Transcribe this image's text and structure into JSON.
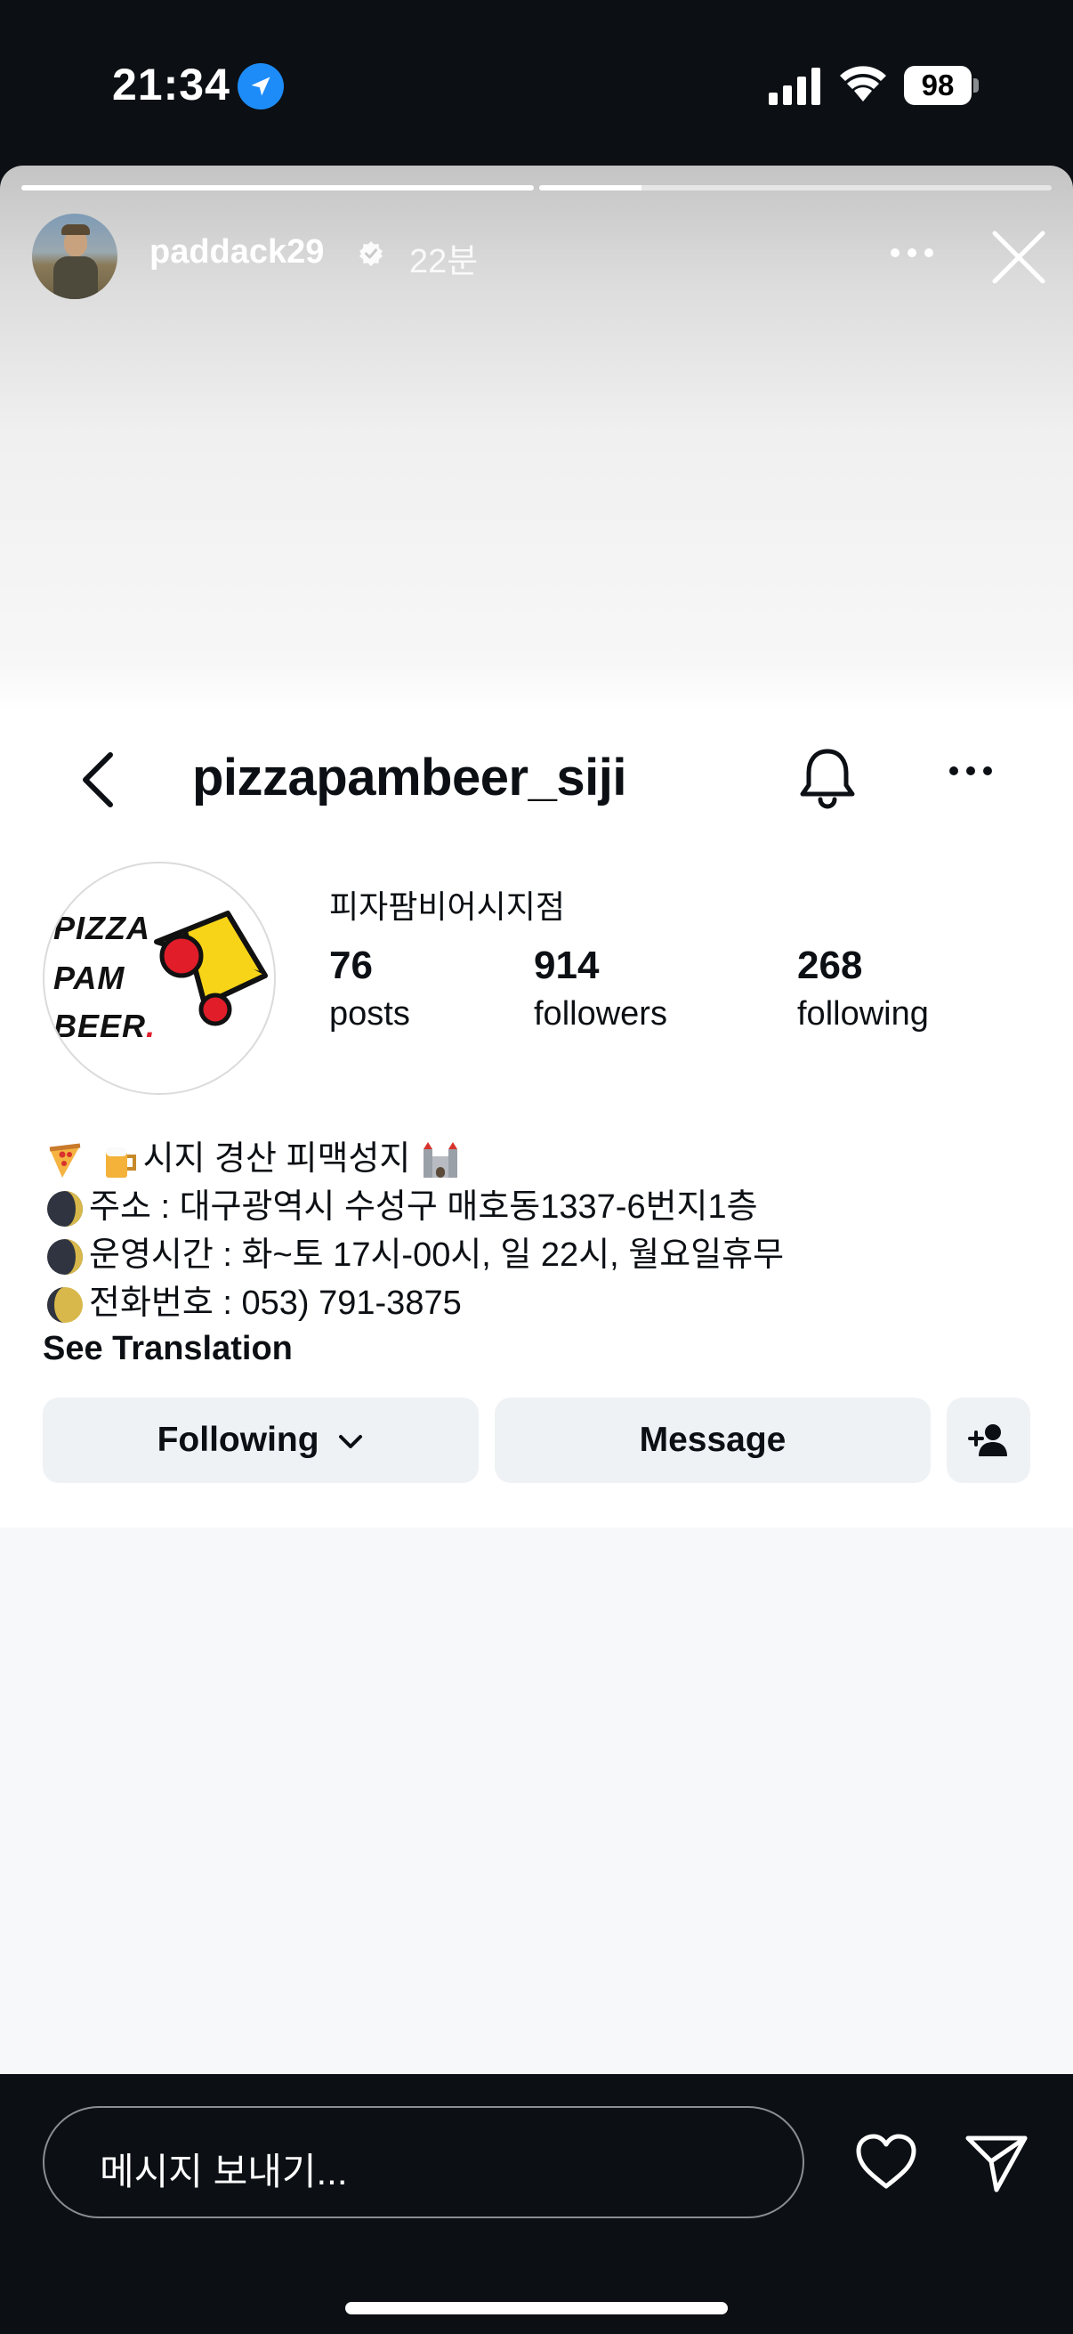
{
  "status_bar": {
    "time": "21:34",
    "battery": "98"
  },
  "story": {
    "username": "paddack29",
    "time_ago": "22분",
    "progress": [
      1.0,
      0.2
    ]
  },
  "profile": {
    "handle": "pizzapambeer_siji",
    "display_name": "피자팜비어시지점",
    "logo_lines": [
      "PIZZA",
      "PAM",
      "BEER"
    ],
    "stats": [
      {
        "value": "76",
        "label": "posts"
      },
      {
        "value": "914",
        "label": "followers"
      },
      {
        "value": "268",
        "label": "following"
      }
    ],
    "bio": [
      "시지 경산 피맥성지",
      "주소 : 대구광역시 수성구 매호동1337-6번지1층",
      "운영시간 : 화~토 17시-00시, 일 22시, 월요일휴무",
      "전화번호 : 053) 791-3875"
    ],
    "see_translation": "See Translation",
    "buttons": {
      "following": "Following",
      "message": "Message"
    }
  },
  "bottom": {
    "placeholder": "메시지 보내기..."
  },
  "colors": {
    "accent_blue": "#1d8cf8",
    "pizza_yellow": "#f7d417",
    "pizza_red": "#e11d2a"
  }
}
